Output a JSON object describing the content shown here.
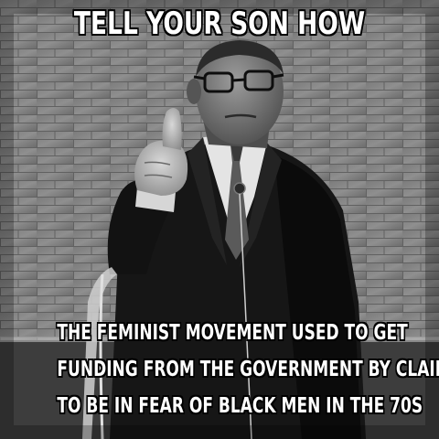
{
  "meme": {
    "top_text": "TELL YOUR SON HOW",
    "bottom_lines": [
      "THE FEMINIST MOVEMENT USED TO GET",
      "FUNDING FROM THE GOVERNMENT BY CLAIMING",
      "TO BE IN FEAR OF BLACK MEN IN THE 70S"
    ]
  },
  "colors": {
    "text": "#ffffff",
    "outline": "#000000",
    "wall": "#9a9a9a",
    "suit": "#161616",
    "shirt": "#e4e4e4"
  }
}
